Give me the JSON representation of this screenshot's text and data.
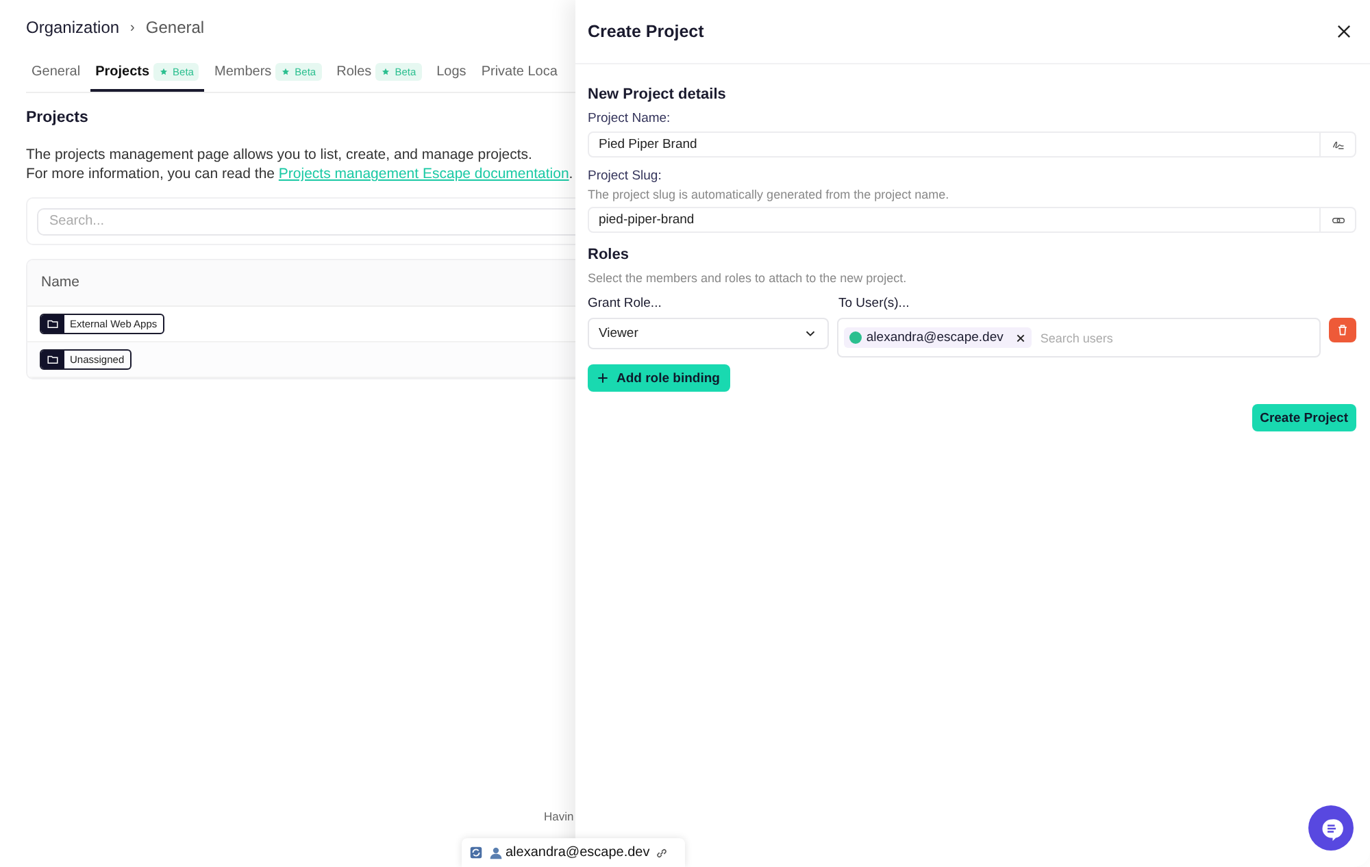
{
  "breadcrumb": [
    "Organization",
    "General"
  ],
  "breadcrumb_separator": "›",
  "tabs": [
    {
      "label": "General",
      "selected": false
    },
    {
      "label": "Projects",
      "selected": true,
      "badge": "Beta"
    },
    {
      "label": "Members",
      "selected": false,
      "badge": "Beta"
    },
    {
      "label": "Roles",
      "selected": false,
      "badge": "Beta"
    },
    {
      "label": "Logs",
      "selected": false
    },
    {
      "label": "Private Loca",
      "selected": false
    }
  ],
  "page": {
    "heading": "Projects",
    "intro": "The projects management page allows you to list, create, and manage projects.",
    "more_prefix": "For more information, you can read the ",
    "link": "Projects management Escape documentation",
    "more_suffix": ".",
    "footer_text": "Havin"
  },
  "search": {
    "placeholder": "Search..."
  },
  "table": {
    "columns": [
      "Name"
    ],
    "rows": [
      {
        "name": "External Web Apps"
      },
      {
        "name": "Unassigned"
      }
    ]
  },
  "drawer": {
    "title": "Create Project",
    "section": "New Project details",
    "name_label": "Project Name:",
    "name_value": "Pied Piper Brand",
    "slug_label": "Project Slug:",
    "slug_hint": "The project slug is automatically generated from the project name.",
    "slug_value": "pied-piper-brand",
    "roles_heading": "Roles",
    "roles_hint": "Select the members and roles to attach to the new project.",
    "role_label": "Grant Role...",
    "users_label": "To User(s)...",
    "bindings": [
      {
        "role": "Viewer",
        "users": [
          {
            "email": "alexandra@escape.dev"
          }
        ],
        "users_placeholder": "Search users"
      }
    ],
    "add_button": "Add role binding",
    "submit_button": "Create Project"
  },
  "toolbar": {
    "user": "alexandra@escape.dev"
  }
}
